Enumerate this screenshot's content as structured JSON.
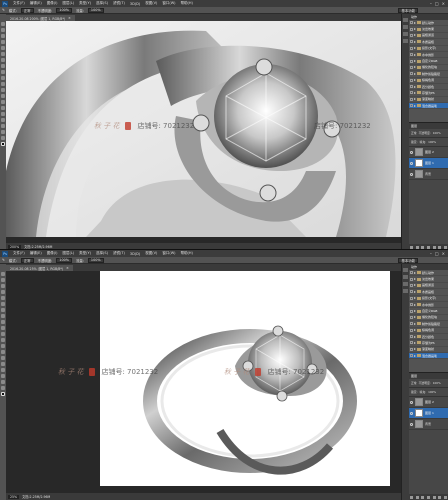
{
  "menu": {
    "logo": "Ps",
    "items": [
      "文件(F)",
      "编辑(E)",
      "图像(I)",
      "图层(L)",
      "类型(Y)",
      "选择(S)",
      "滤镜(T)",
      "3D(D)",
      "视图(V)",
      "窗口(W)",
      "帮助(H)"
    ],
    "controls": [
      "–",
      "□",
      "×"
    ]
  },
  "top": {
    "options": {
      "mode_label": "模式:",
      "mode_value": "正常",
      "opacity_label": "不透明度:",
      "opacity_value": "100%",
      "flow_label": "流量:",
      "flow_value": "100%",
      "workspace": "基本功能"
    },
    "doc_tab": {
      "title": "2016-20-08 200% (图层 1, RGB/8*)",
      "close": "×"
    },
    "status": {
      "zoom": "200%",
      "doc": "文档:2.25M/2.96M"
    },
    "watermark": {
      "signature": "秋 子 花",
      "shop1": "店铺号: 7021232",
      "shop2": "店铺号: 7021232"
    }
  },
  "bottom": {
    "options": {
      "mode_label": "模式:",
      "mode_value": "正常",
      "opacity_label": "不透明度:",
      "opacity_value": "100%",
      "flow_label": "流量:",
      "flow_value": "100%",
      "workspace": "基本功能"
    },
    "doc_tab": {
      "title": "2016-20-08 25% (图层 1, RGB/8*)",
      "close": "×"
    },
    "status": {
      "zoom": "25%",
      "doc": "文档:2.25M/2.96M"
    },
    "watermark": {
      "signature1": "秋 子 花",
      "shop1": "店铺号: 7021232",
      "signature2": "秋 子 花",
      "shop2": "店铺号: 7021232"
    }
  },
  "actions_panel": {
    "title": "动作",
    "items": [
      "默认动作",
      "淡出效果",
      "画框通道",
      "木质画框",
      "投影(文字)",
      "水中倒影",
      "自定义RGB",
      "熔化的铅块",
      "制作剪贴路径",
      "棕褐色调",
      "四分颜色",
      "存储为PS",
      "渐变映射",
      "混合器画笔"
    ]
  },
  "layers_panel": {
    "title": "图层",
    "mode": "正常",
    "opacity_label": "不透明度:",
    "opacity_value": "100%",
    "lock_label": "锁定:",
    "fill_label": "填充:",
    "fill_value": "100%",
    "layers": [
      {
        "name": "图层 2"
      },
      {
        "name": "图层 1"
      },
      {
        "name": "背景"
      }
    ]
  },
  "colors": {
    "accent": "#2f6bb0",
    "chrome": "#535353",
    "dark": "#282828",
    "menu": "#3c3c3c"
  }
}
